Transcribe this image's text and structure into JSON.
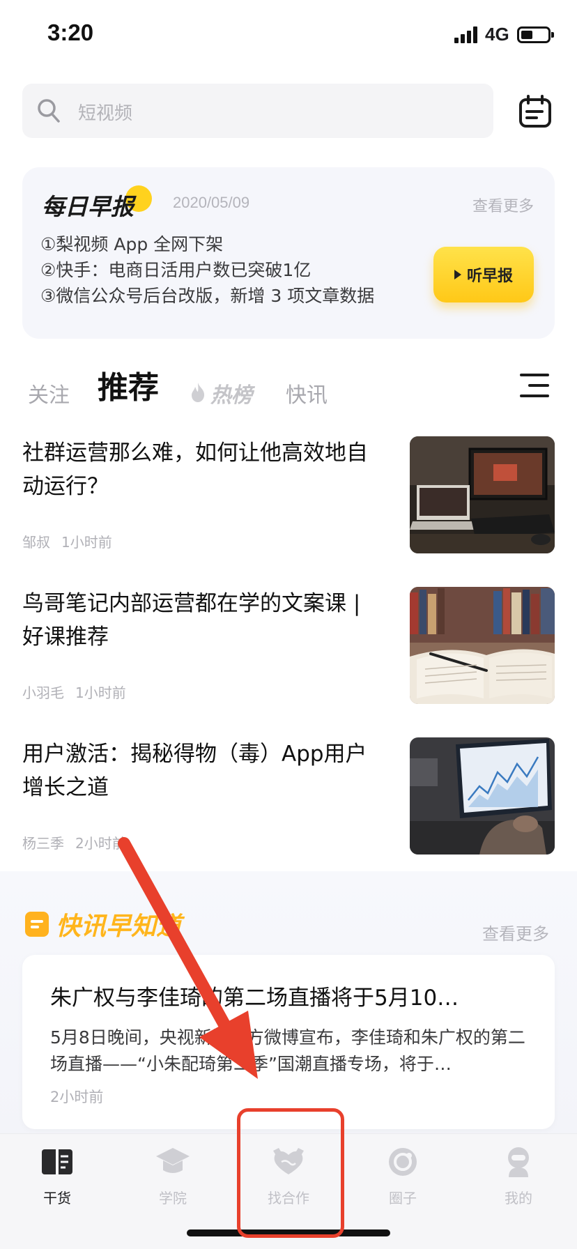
{
  "status_bar": {
    "time": "3:20",
    "network": "4G",
    "battery_level": 0.45
  },
  "search": {
    "placeholder": "短视频"
  },
  "daily_brief": {
    "title": "每日早报",
    "date": "2020/05/09",
    "more_label": "查看更多",
    "items": [
      "①梨视频 App 全网下架",
      "②快手：电商日活用户数已突破1亿",
      "③微信公众号后台改版，新增 3 项文章数据"
    ],
    "listen_label": "听早报"
  },
  "tabs": {
    "follow": "关注",
    "recommend": "推荐",
    "hot": "热榜",
    "flash": "快讯"
  },
  "articles": [
    {
      "title": "社群运营那么难，如何让他高效地自动运行？",
      "author": "邹叔",
      "time": "1小时前"
    },
    {
      "title": "鸟哥笔记内部运营都在学的文案课 | 好课推荐",
      "author": "小羽毛",
      "time": "1小时前"
    },
    {
      "title": "用户激活：揭秘得物（毒）App用户增长之道",
      "author": "杨三季",
      "time": "2小时前"
    }
  ],
  "news_section": {
    "title": "快讯早知道",
    "more_label": "查看更多",
    "card": {
      "title": "朱广权与李佳琦的第二场直播将于5月10…",
      "body": "5月8日晚间，央视新闻官方微博宣布，李佳琦和朱广权的第二场直播——“小朱配琦第二季”国潮直播专场，将于…",
      "time": "2小时前"
    }
  },
  "tabbar": {
    "items": [
      "干货",
      "学院",
      "找合作",
      "圈子",
      "我的"
    ],
    "active": "干货"
  },
  "colors": {
    "accent_yellow": "#ffd21e",
    "news_orange": "#ffb51c",
    "annotation_red": "#e8402c"
  }
}
